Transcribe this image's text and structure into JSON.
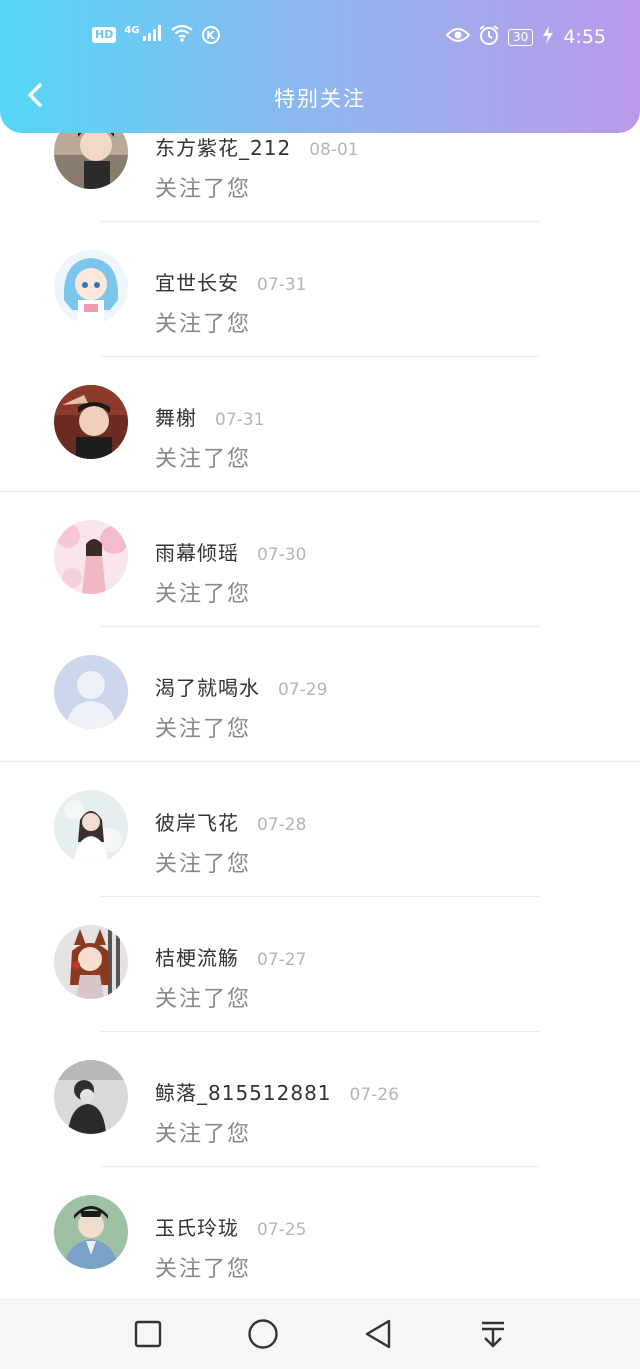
{
  "status_bar": {
    "left_badge": "HD",
    "network": "4G",
    "k_icon": "K",
    "battery": "30",
    "time": "4:55"
  },
  "header": {
    "title": "特别关注"
  },
  "list": [
    {
      "name": "东方紫花_212",
      "date": "08-01",
      "action": "关注了您",
      "avatar": "avatar-boy-1"
    },
    {
      "name": "宜世长安",
      "date": "07-31",
      "action": "关注了您",
      "avatar": "avatar-anime-blue"
    },
    {
      "name": "舞榭",
      "date": "07-31",
      "action": "关注了您",
      "avatar": "avatar-man-dark"
    },
    {
      "name": "雨幕倾瑶",
      "date": "07-30",
      "action": "关注了您",
      "avatar": "avatar-pink-blossom"
    },
    {
      "name": "渴了就喝水",
      "date": "07-29",
      "action": "关注了您",
      "avatar": "avatar-default"
    },
    {
      "name": "彼岸飞花",
      "date": "07-28",
      "action": "关注了您",
      "avatar": "avatar-girl-white"
    },
    {
      "name": "桔梗流觞",
      "date": "07-27",
      "action": "关注了您",
      "avatar": "avatar-anime-fox"
    },
    {
      "name": "鲸落_815512881",
      "date": "07-26",
      "action": "关注了您",
      "avatar": "avatar-bw"
    },
    {
      "name": "玉氏玲珑",
      "date": "07-25",
      "action": "关注了您",
      "avatar": "avatar-man-blue"
    }
  ],
  "nav": [
    "square-icon",
    "circle-icon",
    "triangle-back-icon",
    "pull-down-icon"
  ]
}
